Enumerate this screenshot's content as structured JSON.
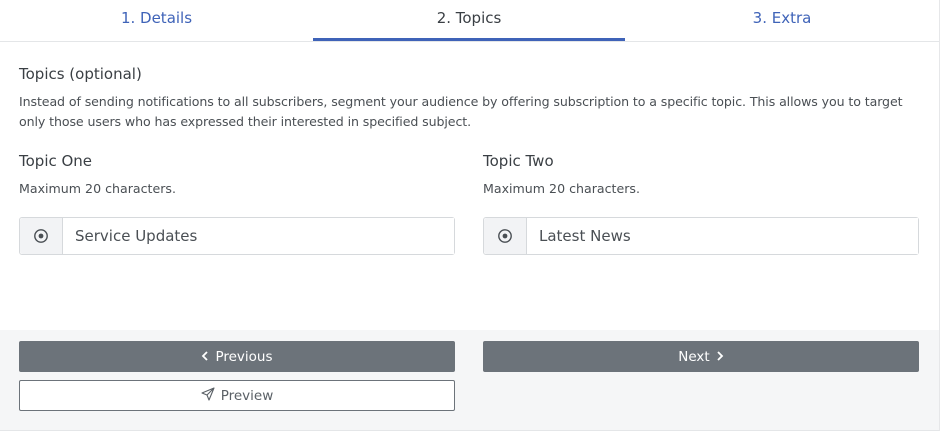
{
  "tabs": [
    {
      "label": "1. Details"
    },
    {
      "label": "2. Topics"
    },
    {
      "label": "3. Extra"
    }
  ],
  "section": {
    "title": "Topics (optional)",
    "description": "Instead of sending notifications to all subscribers, segment your audience by offering subscription to a specific topic. This allows you to target only those users who has expressed their interested in specified subject."
  },
  "topic_one": {
    "title": "Topic One",
    "help": "Maximum 20 characters.",
    "value": "Service Updates",
    "icon": "target-icon"
  },
  "topic_two": {
    "title": "Topic Two",
    "help": "Maximum 20 characters.",
    "value": "Latest News",
    "icon": "target-icon"
  },
  "buttons": {
    "previous": "Previous",
    "next": "Next",
    "preview": "Preview"
  },
  "colors": {
    "accent": "#3f63b8",
    "button_dark": "#6c737a"
  }
}
